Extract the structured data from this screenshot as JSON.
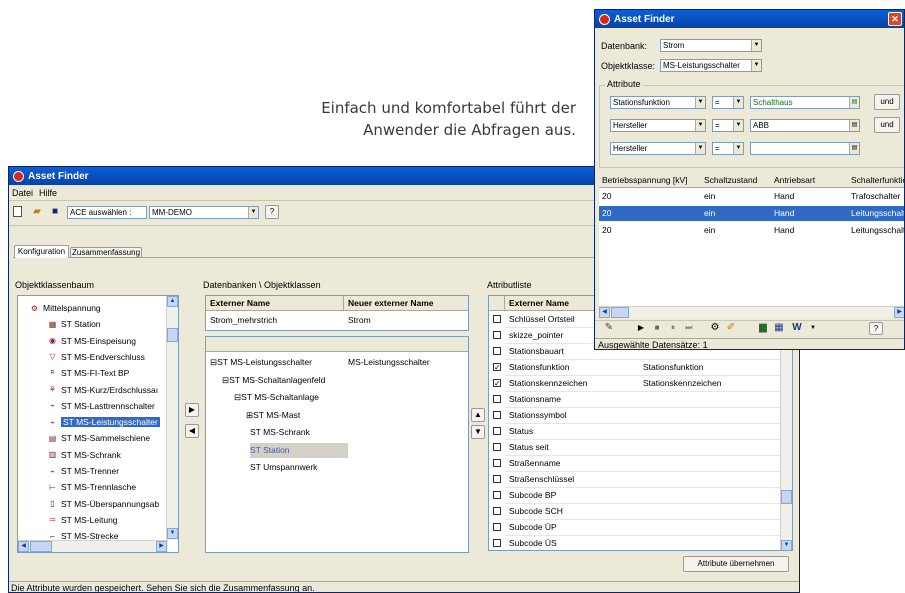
{
  "caption": {
    "line1": "Einfach und komfortabel führt der",
    "line2": "Anwender die Abfragen aus."
  },
  "main": {
    "title": "Asset Finder",
    "menu": [
      "Datei",
      "Hilfe"
    ],
    "toolbar": {
      "ace_label": "ACE auswählen :",
      "ace_value": "MM-DEMO"
    },
    "tabs": [
      "Konfiguration",
      "Zusammenfassung"
    ],
    "tree_header": "Objektklassenbaum",
    "tree_items": [
      {
        "label": "Mittelspannung",
        "icon": "⚙"
      },
      {
        "label": "ST Station",
        "icon": "▦"
      },
      {
        "label": "ST MS-Einspeisung",
        "icon": "◉"
      },
      {
        "label": "ST MS-Endverschluss",
        "icon": "▽"
      },
      {
        "label": "ST MS-FI-Text BP",
        "icon": "ᴿ"
      },
      {
        "label": "ST MS-Kurz/Erdschlussaı",
        "icon": "⚘"
      },
      {
        "label": "ST MS-Lasttrennschalter",
        "icon": "⌁"
      },
      {
        "label": "ST MS-Leistungsschalter",
        "icon": "⌁"
      },
      {
        "label": "ST MS-Sammelschiene",
        "icon": "▤"
      },
      {
        "label": "ST MS-Schrank",
        "icon": "▥"
      },
      {
        "label": "ST MS-Trenner",
        "icon": "⌁"
      },
      {
        "label": "ST MS-Trennlasche",
        "icon": "⊢"
      },
      {
        "label": "ST MS-Überspannungsab",
        "icon": "▯"
      },
      {
        "label": "ST MS-Leitung",
        "icon": "═"
      },
      {
        "label": "ST MS-Strecke",
        "icon": "⌐"
      }
    ],
    "db_header": "Datenbanken \\ Objektklassen",
    "db_col1": "Externer Name",
    "db_col2": "Neuer externer Name",
    "db_row": {
      "ext": "Strom_mehrstrich",
      "new": "Strom"
    },
    "db_tree": [
      {
        "label": "ST MS-Leistungsschalter",
        "new": "MS-Leistungsschalter",
        "prefix": "⊟"
      },
      {
        "label": "ST MS-Schaltanlagenfeld",
        "new": "",
        "prefix": "⊟"
      },
      {
        "label": "ST MS-Schaltanlage",
        "new": "",
        "prefix": "⊟"
      },
      {
        "label": "ST MS-Mast",
        "new": "",
        "prefix": "⊞"
      },
      {
        "label": "ST MS-Schrank",
        "new": "",
        "prefix": ""
      },
      {
        "label": "ST Station",
        "new": "",
        "prefix": ""
      },
      {
        "label": "ST Umspannwerk",
        "new": "",
        "prefix": ""
      }
    ],
    "attr_header": "Attributliste",
    "attr_col1": "Externer Name",
    "attributes": [
      {
        "name": "Schlüssel Ortsteil",
        "checked": false,
        "new": ""
      },
      {
        "name": "skizze_pointer",
        "checked": false,
        "new": ""
      },
      {
        "name": "Stationsbauart",
        "checked": false,
        "new": ""
      },
      {
        "name": "Stationsfunktion",
        "checked": true,
        "new": "Stationsfunktion"
      },
      {
        "name": "Stationskennzeichen",
        "checked": true,
        "new": "Stationskennzeichen"
      },
      {
        "name": "Stationsname",
        "checked": false,
        "new": ""
      },
      {
        "name": "Stationssymbol",
        "checked": false,
        "new": ""
      },
      {
        "name": "Status",
        "checked": false,
        "new": ""
      },
      {
        "name": "Status seit",
        "checked": false,
        "new": ""
      },
      {
        "name": "Straßenname",
        "checked": false,
        "new": ""
      },
      {
        "name": "Straßenschlüssel",
        "checked": false,
        "new": ""
      },
      {
        "name": "Subcode BP",
        "checked": false,
        "new": ""
      },
      {
        "name": "Subcode SCH",
        "checked": false,
        "new": ""
      },
      {
        "name": "Subcode ÜP",
        "checked": false,
        "new": ""
      },
      {
        "name": "Subcode ÜS",
        "checked": false,
        "new": ""
      }
    ],
    "apply_button": "Attribute übernehmen",
    "status": "Die Attribute wurden gespeichert. Sehen Sie sich die Zusammenfassung an."
  },
  "finder": {
    "title": "Asset Finder",
    "db_label": "Datenbank:",
    "db_value": "Strom",
    "class_label": "Objektklasse:",
    "class_value": "MS-Leistungsschalter",
    "attr_group": "Attribute",
    "conditions": [
      {
        "attr": "Stationsfunktion",
        "op": "=",
        "value": "Schalthaus",
        "logic": "und"
      },
      {
        "attr": "Hersteller",
        "op": "=",
        "value": "ABB",
        "logic": "und"
      },
      {
        "attr": "Hersteller",
        "op": "=",
        "value": "",
        "logic": ""
      }
    ],
    "columns": [
      "Betriebsspannung [kV]",
      "Schaltzustand",
      "Antriebsart",
      "Schalterfunktio"
    ],
    "rows": [
      [
        "20",
        "ein",
        "Hand",
        "Trafoschalter"
      ],
      [
        "20",
        "ein",
        "Hand",
        "Leitungsschalt"
      ],
      [
        "20",
        "ein",
        "Hand",
        "Leitungsschalt"
      ]
    ],
    "status": "Ausgewählte Datensätze: 1"
  },
  "colors": {
    "titlebar": "#0a5fd8",
    "selection": "#316ac5",
    "window_bg": "#ece9d8"
  }
}
